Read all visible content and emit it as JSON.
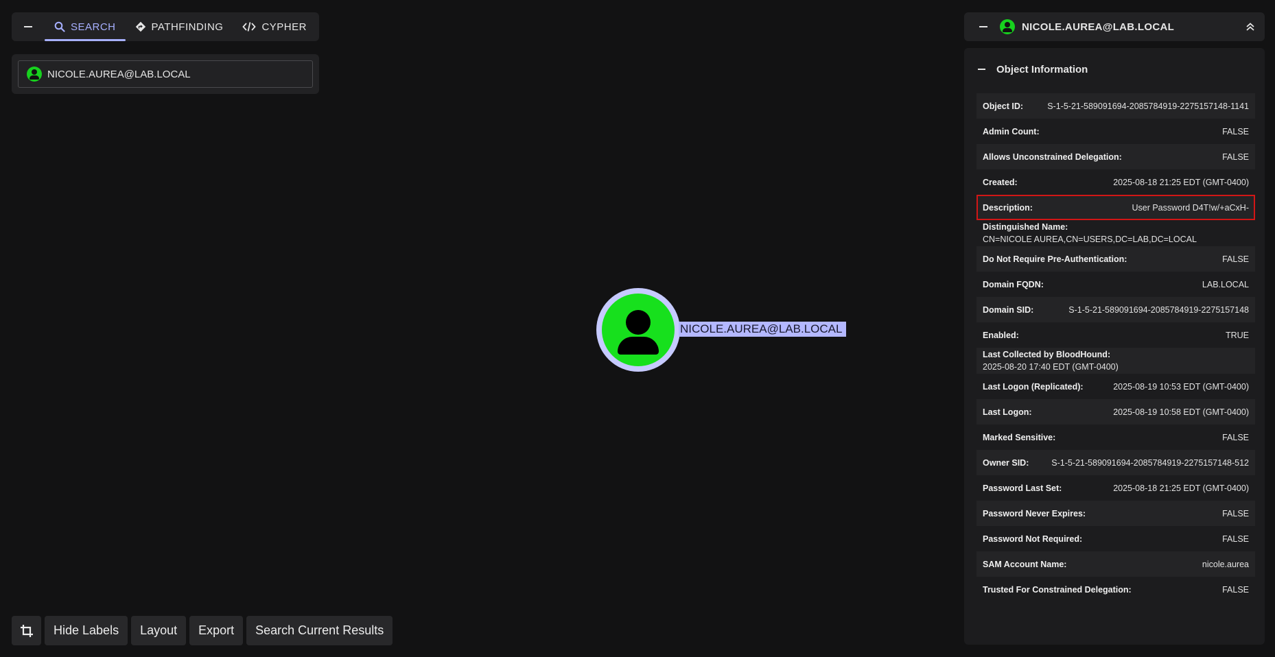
{
  "tabs": [
    {
      "label": "SEARCH",
      "icon": "search-icon",
      "active": true
    },
    {
      "label": "PATHFINDING",
      "icon": "pathfinding-icon",
      "active": false
    },
    {
      "label": "CYPHER",
      "icon": "code-icon",
      "active": false
    }
  ],
  "search": {
    "value": "NICOLE.AUREA@LAB.LOCAL"
  },
  "graph": {
    "node_label": "NICOLE.AUREA@LAB.LOCAL"
  },
  "toolbar": {
    "hide_labels": "Hide Labels",
    "layout": "Layout",
    "export": "Export",
    "search_current": "Search Current Results"
  },
  "right_panel": {
    "title": "NICOLE.AUREA@LAB.LOCAL",
    "section_title": "Object Information",
    "properties": [
      {
        "label": "Object ID:",
        "value": "S-1-5-21-589091694-2085784919-2275157148-1141"
      },
      {
        "label": "Admin Count:",
        "value": "FALSE"
      },
      {
        "label": "Allows Unconstrained Delegation:",
        "value": "FALSE"
      },
      {
        "label": "Created:",
        "value": "2025-08-18 21:25 EDT (GMT-0400)"
      },
      {
        "label": "Description:",
        "value": "User Password D4T!w/+aCxH-"
      },
      {
        "label": "Distinguished Name:",
        "value": "CN=NICOLE AUREA,CN=USERS,DC=LAB,DC=LOCAL"
      },
      {
        "label": "Do Not Require Pre-Authentication:",
        "value": "FALSE"
      },
      {
        "label": "Domain FQDN:",
        "value": "LAB.LOCAL"
      },
      {
        "label": "Domain SID:",
        "value": "S-1-5-21-589091694-2085784919-2275157148"
      },
      {
        "label": "Enabled:",
        "value": "TRUE"
      },
      {
        "label": "Last Collected by BloodHound:",
        "value": "2025-08-20 17:40 EDT (GMT-0400)"
      },
      {
        "label": "Last Logon (Replicated):",
        "value": "2025-08-19 10:53 EDT (GMT-0400)"
      },
      {
        "label": "Last Logon:",
        "value": "2025-08-19 10:58 EDT (GMT-0400)"
      },
      {
        "label": "Marked Sensitive:",
        "value": "FALSE"
      },
      {
        "label": "Owner SID:",
        "value": "S-1-5-21-589091694-2085784919-2275157148-512"
      },
      {
        "label": "Password Last Set:",
        "value": "2025-08-18 21:25 EDT (GMT-0400)"
      },
      {
        "label": "Password Never Expires:",
        "value": "FALSE"
      },
      {
        "label": "Password Not Required:",
        "value": "FALSE"
      },
      {
        "label": "SAM Account Name:",
        "value": "nicole.aurea"
      },
      {
        "label": "Trusted For Constrained Delegation:",
        "value": "FALSE"
      }
    ]
  },
  "colors": {
    "accent": "#a7b0ff",
    "user_node": "#17e01d",
    "highlight_border": "#d21616"
  }
}
